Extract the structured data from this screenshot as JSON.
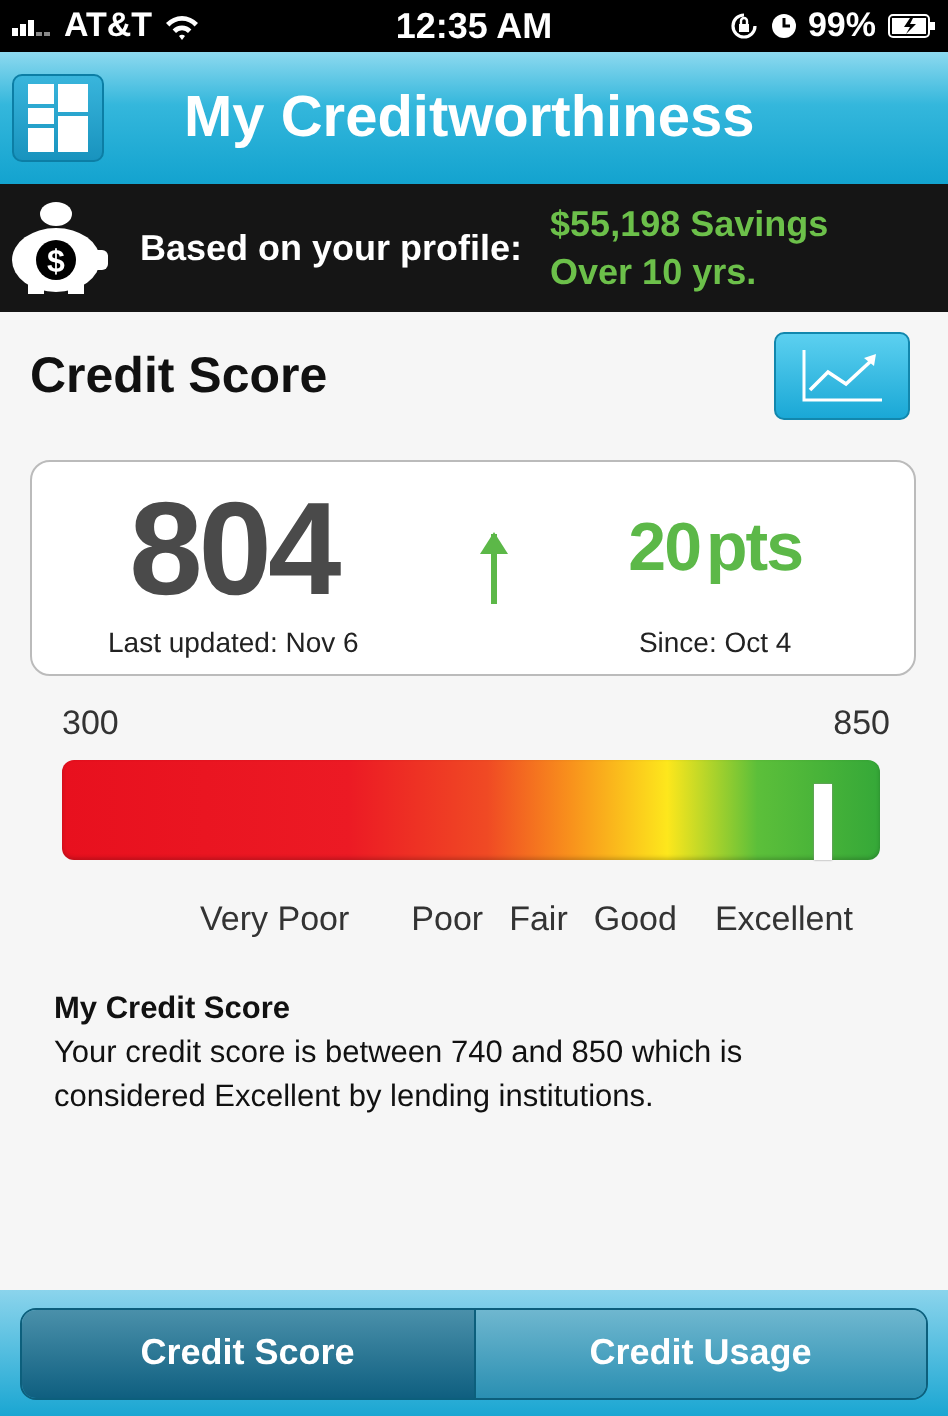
{
  "status_bar": {
    "carrier": "AT&T",
    "time": "12:35 AM",
    "battery": "99%"
  },
  "header": {
    "title": "My Creditworthiness"
  },
  "banner": {
    "icon_symbol": "$",
    "label": "Based on your profile:",
    "savings": "$55,198 Savings",
    "period": "Over 10 yrs."
  },
  "credit_score": {
    "title": "Credit Score",
    "score": "804",
    "last_updated": "Last updated: Nov 6",
    "change": "20",
    "change_unit": "pts",
    "since": "Since: Oct 4",
    "rising": true
  },
  "meter": {
    "min": "300",
    "max": "850",
    "level": 0.92,
    "labels": [
      "Very Poor",
      "Poor",
      "Fair",
      "Good",
      "Excellent"
    ]
  },
  "description": {
    "title": "My Credit Score",
    "text": "Your credit score is between 740 and 850 which is considered Excellent by lending institutions."
  },
  "tabs": [
    {
      "label": "Credit Score",
      "selected": true
    },
    {
      "label": "Credit Usage",
      "selected": false
    }
  ]
}
